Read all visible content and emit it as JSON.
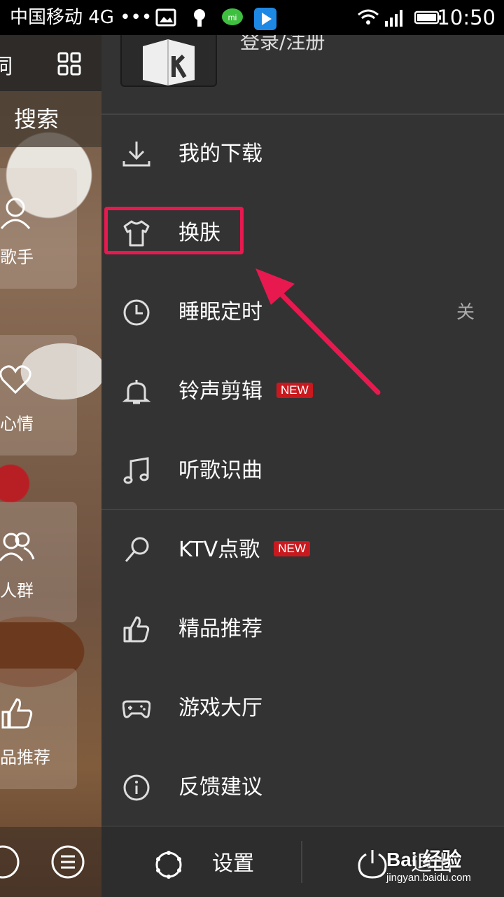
{
  "status_bar": {
    "carrier": "中国移动 4G •••",
    "time": "10:50",
    "icons": [
      "picture-icon",
      "hand-icon",
      "mi-icon",
      "play-store-icon",
      "wifi-icon",
      "signal-icon",
      "battery-icon"
    ]
  },
  "background_app": {
    "search_label": "搜索",
    "cards": [
      {
        "label": "歌手",
        "icon": "person-icon"
      },
      {
        "label": "心情",
        "icon": "heart-icon"
      },
      {
        "label": "人群",
        "icon": "people-icon"
      },
      {
        "label": "品推荐",
        "icon": "thumb-up-icon"
      }
    ],
    "top_left_text": "词"
  },
  "drawer": {
    "login_label": "登录/注册",
    "items": [
      {
        "label": "我的下载",
        "icon": "download-icon"
      },
      {
        "label": "换肤",
        "icon": "tshirt-icon"
      },
      {
        "label": "睡眠定时",
        "icon": "clock-icon",
        "right_text": "关"
      },
      {
        "label": "铃声剪辑",
        "icon": "bell-icon",
        "badge": "NEW"
      },
      {
        "label": "听歌识曲",
        "icon": "music-note-icon"
      },
      {
        "label": "KTV点歌",
        "icon": "microphone-icon",
        "badge": "NEW"
      },
      {
        "label": "精品推荐",
        "icon": "thumb-up-icon"
      },
      {
        "label": "游戏大厅",
        "icon": "gamepad-icon"
      },
      {
        "label": "反馈建议",
        "icon": "info-icon"
      }
    ],
    "footer": {
      "settings_label": "设置",
      "exit_label": "退出"
    }
  },
  "annotation": {
    "highlight_color": "#e8194f"
  },
  "watermark": {
    "brand": "Bai 经验",
    "url": "jingyan.baidu.com"
  }
}
